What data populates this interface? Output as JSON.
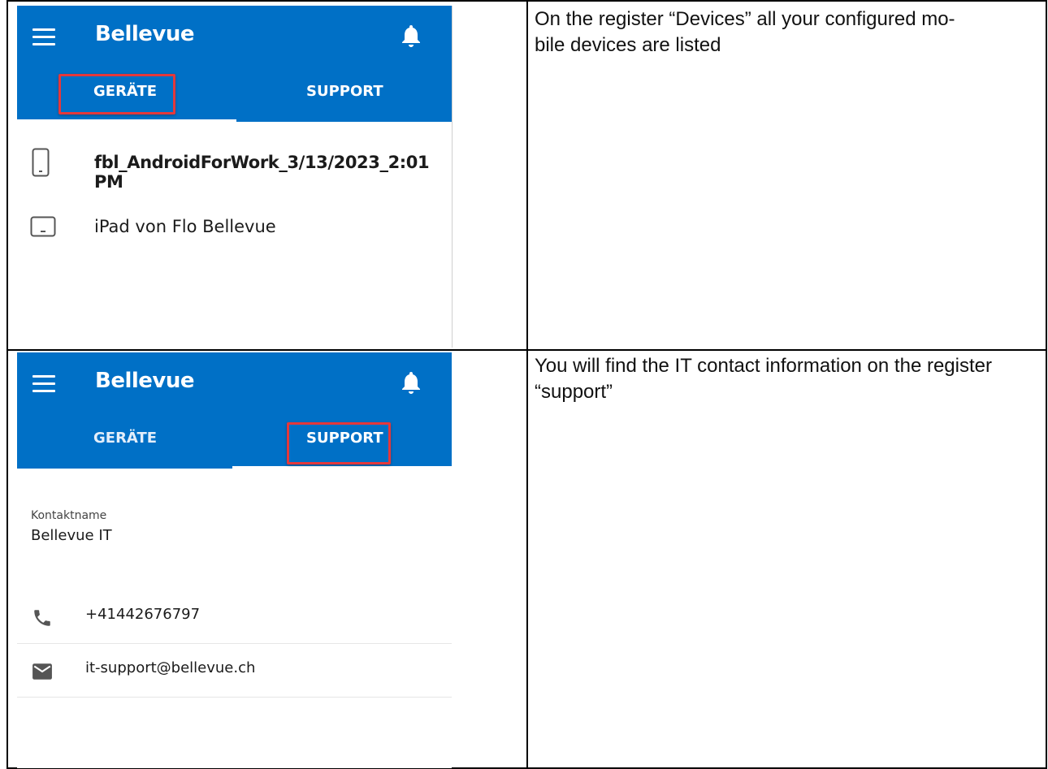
{
  "panel_devices": {
    "app_title": "Bellevue",
    "tabs": [
      {
        "label": "GERÄTE"
      },
      {
        "label": "SUPPORT"
      }
    ],
    "devices": [
      {
        "label": "fbl_AndroidForWork_3/13/2023_2:01 PM",
        "icon": "phone-icon"
      },
      {
        "label": "iPad von Flo Bellevue",
        "icon": "tablet-icon"
      }
    ]
  },
  "panel_support": {
    "app_title": "Bellevue",
    "tabs": [
      {
        "label": "GERÄTE"
      },
      {
        "label": "SUPPORT"
      }
    ],
    "contact_name_label": "Kontaktname",
    "contact_name": "Bellevue IT",
    "phone": "+41442676797",
    "email": "it-support@bellevue.ch"
  },
  "captions": {
    "devices": "On the register “Devices” all your configured mo-\nbile devices are listed",
    "support": "You will find the IT contact information on the register “support”"
  },
  "colors": {
    "appbar": "#0070c6",
    "highlight": "#e5383b"
  }
}
